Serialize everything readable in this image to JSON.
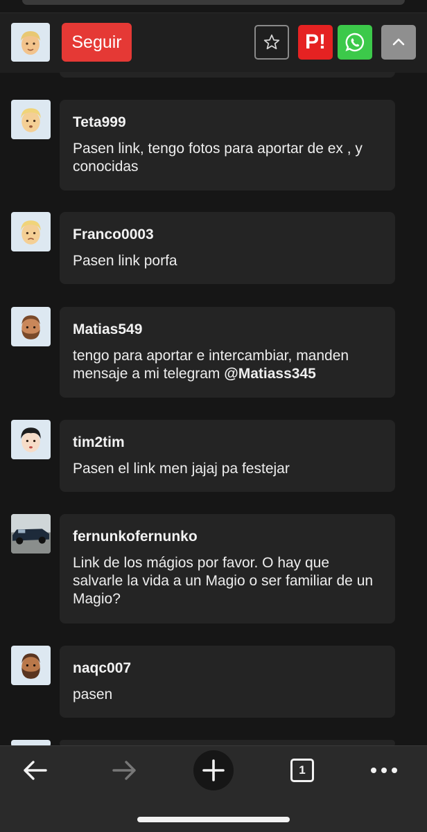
{
  "header": {
    "follow_label": "Seguir",
    "buttons": [
      "star-icon",
      "p-logo-icon",
      "whatsapp-icon",
      "chevron-up-icon"
    ],
    "p_logo_text": "P!"
  },
  "comments": [
    {
      "username": "Teta999",
      "text": "Pasen link, tengo fotos para aportar de ex , y conocidas"
    },
    {
      "username": "Franco0003",
      "text": "Pasen link porfa"
    },
    {
      "username": "Matias549",
      "text": "tengo para aportar e intercambiar, manden mensaje a mi telegram ",
      "mention": "@Matiass345"
    },
    {
      "username": "tim2tim",
      "text": "Pasen el link men jajaj pa festejar"
    },
    {
      "username": "fernunkofernunko",
      "text": "Link de los mágios por favor. O hay que salvarle la vida a un Magio o ser familiar de un Magio?"
    },
    {
      "username": "naqc007",
      "text": "pasen"
    }
  ],
  "bottom_nav": {
    "tab_count": "1",
    "icons": [
      "back-arrow-icon",
      "forward-arrow-icon",
      "new-tab-plus-icon",
      "tabs-icon",
      "more-icon"
    ]
  },
  "colors": {
    "follow": "#e53935",
    "p_logo": "#e52222",
    "whatsapp": "#3cc94a",
    "card": "#242424",
    "background": "#161616"
  }
}
